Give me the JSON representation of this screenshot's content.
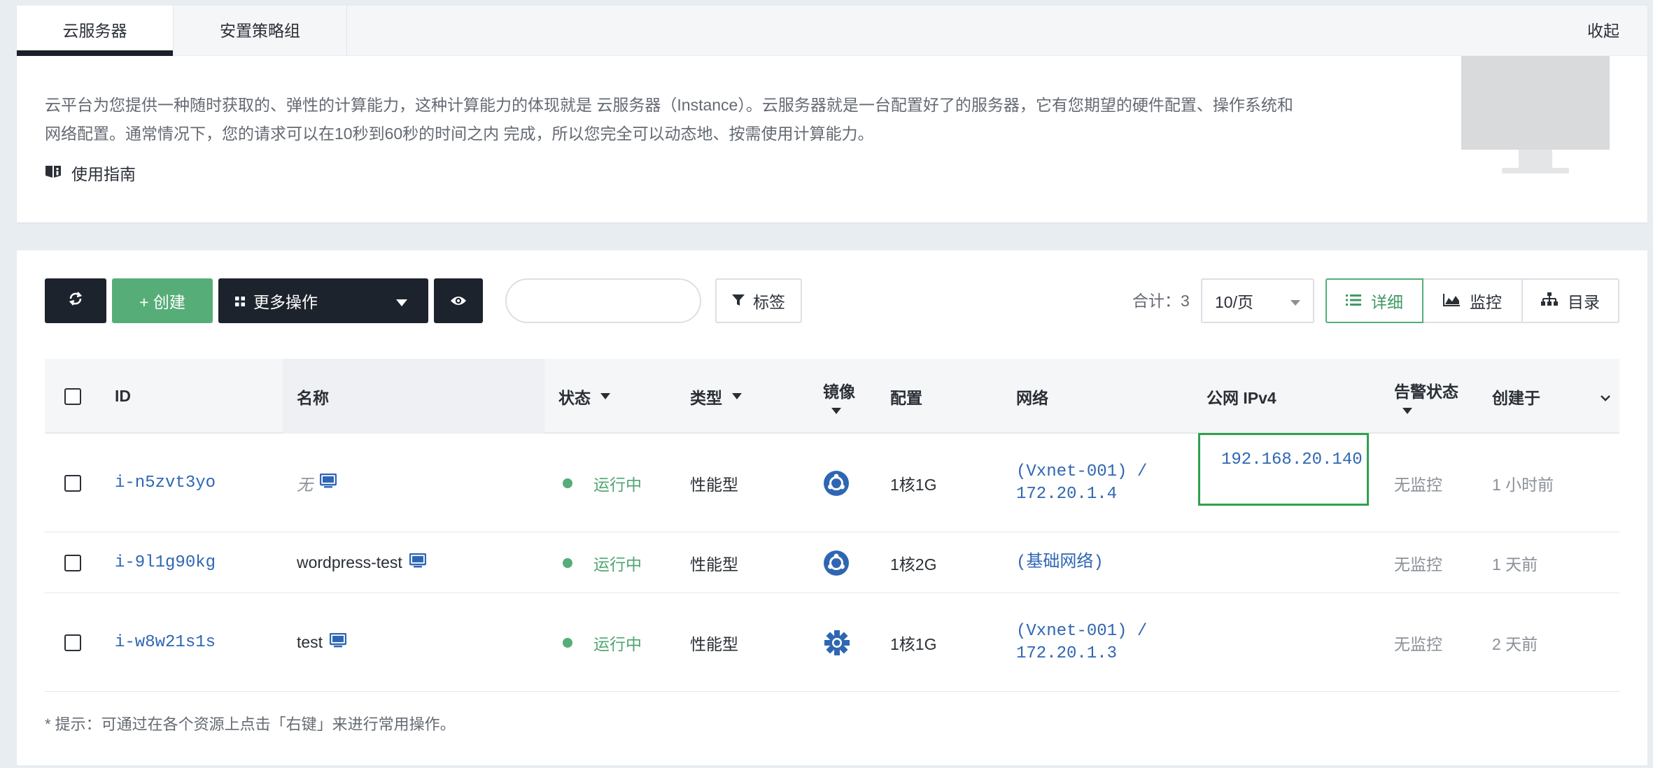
{
  "tabs": [
    {
      "label": "云服务器",
      "active": true
    },
    {
      "label": "安置策略组",
      "active": false
    }
  ],
  "collapse_label": "收起",
  "intro": {
    "line1": "云平台为您提供一种随时获取的、弹性的计算能力，这种计算能力的体现就是 云服务器（Instance）。云服务器就是一台配置好了的服务器，它有您期望的硬件配置、操作系统和",
    "line2": "网络配置。通常情况下，您的请求可以在10秒到60秒的时间之内 完成，所以您完全可以动态地、按需使用计算能力。",
    "guide_label": "使用指南"
  },
  "toolbar": {
    "create_label": "+ 创建",
    "more_actions_label": "更多操作",
    "search_placeholder": "",
    "tag_label": "标签",
    "total_text": "合计：3",
    "page_size": "10/页",
    "views": [
      "详细",
      "监控",
      "目录"
    ],
    "active_view": "详细"
  },
  "columns": {
    "id": "ID",
    "name": "名称",
    "status": "状态",
    "type": "类型",
    "image": "镜像",
    "config": "配置",
    "network": "网络",
    "public_ip": "公网 IPv4",
    "alert": "告警状态",
    "created": "创建于"
  },
  "rows": [
    {
      "id": "i-n5zvt3yo",
      "name": "无",
      "name_italic": true,
      "status": "运行中",
      "type": "性能型",
      "image_icon": "ubuntu-icon",
      "config": "1核1G",
      "network_line1": "(Vxnet-001) /",
      "network_line2": "172.20.1.4",
      "public_ip": "192.168.20.140",
      "alert": "无监控",
      "created": "1 小时前"
    },
    {
      "id": "i-9l1g90kg",
      "name": "wordpress-test",
      "name_italic": false,
      "status": "运行中",
      "type": "性能型",
      "image_icon": "ubuntu-icon",
      "config": "1核2G",
      "network_line1": "(基础网络)",
      "network_line2": "",
      "public_ip": "",
      "alert": "无监控",
      "created": "1 天前"
    },
    {
      "id": "i-w8w21s1s",
      "name": "test",
      "name_italic": false,
      "status": "运行中",
      "type": "性能型",
      "image_icon": "centos-icon",
      "config": "1核1G",
      "network_line1": "(Vxnet-001) /",
      "network_line2": "172.20.1.3",
      "public_ip": "",
      "alert": "无监控",
      "created": "2 天前"
    }
  ],
  "hint": "* 提示：可通过在各个资源上点击「右键」来进行常用操作。",
  "colors": {
    "accent_green": "#56ad78",
    "link_blue": "#2f66b3",
    "dark": "#1d232c",
    "highlight_box": "#2fa14e"
  }
}
